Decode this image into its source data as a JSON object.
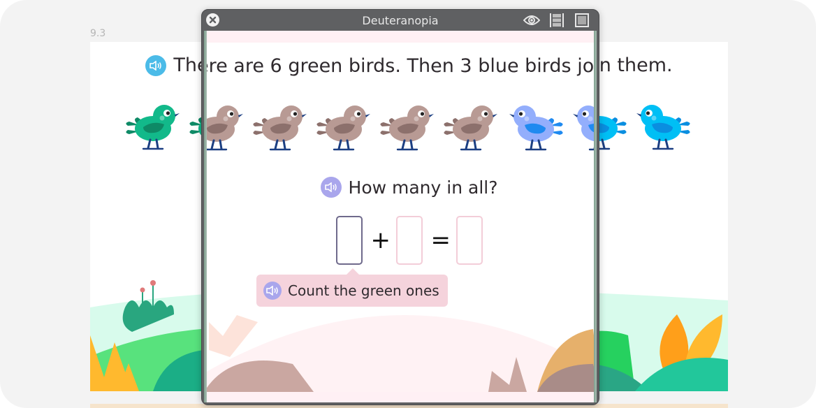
{
  "lesson": {
    "number": "9.3"
  },
  "question": {
    "text": "There are 6 green birds. Then 3 blue birds join them.",
    "speaker_icon": "speaker-icon"
  },
  "birds": {
    "green_count": 6,
    "blue_count": 3,
    "colors": {
      "green_body": "#12b98a",
      "green_wing": "#0e8a66",
      "blue_body": "#00bff5",
      "blue_wing": "#0a8ee0",
      "sim_green_body": "#b89a94",
      "sim_green_wing": "#8c706c",
      "sim_blue_body": "#93aefc",
      "sim_blue_wing": "#1f8af0"
    }
  },
  "prompt": {
    "text": "How many in all?"
  },
  "equation": {
    "boxes": [
      "",
      "",
      ""
    ],
    "plus": "+",
    "equals": "=",
    "active_box": 0
  },
  "hint": {
    "text": "Count the green ones"
  },
  "simulator": {
    "title": "Deuteranopia",
    "close_icon": "close-icon",
    "icons": [
      "eye-icon",
      "split-view-icon",
      "fullscreen-icon"
    ]
  },
  "colors": {
    "speaker_blue": "#4bbbe8",
    "speaker_purple": "#a9a6ec",
    "hint_bg": "#f5d3dc"
  }
}
